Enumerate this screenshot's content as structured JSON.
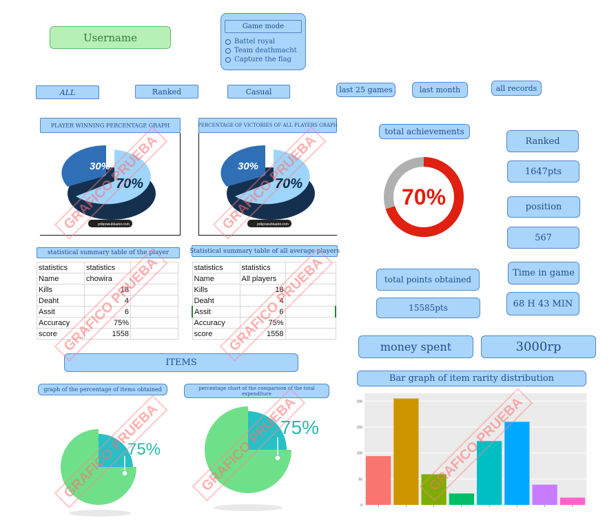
{
  "username": "Username",
  "game_mode": {
    "title": "Game mode",
    "options": [
      "Battel royal",
      "Team deathmacht",
      "Capture the flag"
    ]
  },
  "filters": {
    "mode": [
      "ALL",
      "Ranked",
      "Casual"
    ],
    "period": [
      "last 25 games",
      "last month",
      "all records"
    ]
  },
  "player_graph": {
    "title": "PLAYER WINNING PERCENTAGE GRAPH",
    "small": "30%",
    "big": "70%",
    "credit": "prikpowubluator.com"
  },
  "all_graph": {
    "title": "PERCENTAGE OF VICTORIES OF ALL PLAYERS GRAPH",
    "small": "30%",
    "big": "70%",
    "credit": "prikpowubluator.com"
  },
  "achievements": {
    "title": "total achievements",
    "value": "70%",
    "fraction": 0.7
  },
  "rank": {
    "ranked": "Ranked",
    "points": "1647pts",
    "position_label": "position",
    "position_value": "567",
    "time_label": "Time in game",
    "time_value": "68 H 43 MIN"
  },
  "total_points": {
    "label": "total points obtained",
    "value": "15585pts"
  },
  "player_table": {
    "title": "statistical summary table of the player",
    "header": [
      "statistics",
      "statistics"
    ],
    "rows": [
      [
        "Name",
        "chowira"
      ],
      [
        "Kills",
        "18"
      ],
      [
        "Deaht",
        "4"
      ],
      [
        "Assit",
        "6"
      ],
      [
        "Accuracy",
        "75%"
      ],
      [
        "score",
        "1558"
      ]
    ]
  },
  "all_table": {
    "title": "Statistical summary table of all average players",
    "header": [
      "statistics",
      "statistics"
    ],
    "rows": [
      [
        "Name",
        "All players"
      ],
      [
        "Kills",
        "18"
      ],
      [
        "Deaht",
        "4"
      ],
      [
        "Assit",
        "6"
      ],
      [
        "Accuracy",
        "75%"
      ],
      [
        "score",
        "1558"
      ]
    ]
  },
  "money": {
    "label": "money spent",
    "value": "3000rp"
  },
  "items": {
    "title": "ITEMS",
    "chart1_title": "graph of the percentage of items obtained",
    "chart2_title": "percentage chart of the comparison of the total expenditure",
    "chart1_value": "75%",
    "chart2_value": "75%"
  },
  "watermark": "GRAFICO PRUEBA",
  "colors": {
    "box": "#a9d5fb",
    "border": "#4f86c6",
    "green": "#b6f0b6",
    "red": "#e02010"
  },
  "bar_title": "Bar graph of item rarity distribution",
  "chart_data": {
    "type": "bar",
    "title": "Bar graph of item rarity distribution",
    "categories": [
      "",
      "",
      "",
      "",
      "",
      "",
      "",
      ""
    ],
    "values": [
      94,
      205,
      59,
      22,
      123,
      160,
      39,
      14
    ],
    "colors": [
      "#f8766d",
      "#cd9600",
      "#7cae00",
      "#00be67",
      "#00bfc4",
      "#00a9ff",
      "#c77cff",
      "#ff61cc"
    ],
    "yticks": [
      "0",
      "50",
      "100",
      "150",
      "200"
    ],
    "ylim": [
      0,
      215
    ],
    "grid": true
  }
}
